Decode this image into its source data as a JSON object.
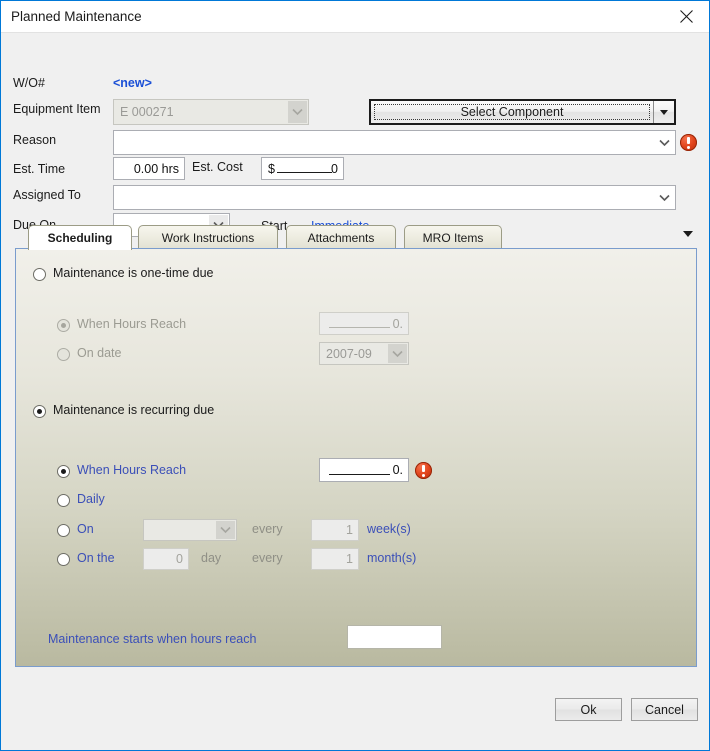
{
  "window": {
    "title": "Planned Maintenance",
    "close_icon": "close-icon"
  },
  "header": {
    "wo_label": "W/O#",
    "wo_value": "<new>",
    "equipment_label": "Equipment Item",
    "equipment_value": "E 000271",
    "select_component_label": "Select Component",
    "reason_label": "Reason",
    "reason_value": "",
    "est_time_label": "Est. Time",
    "est_time_value": "0.00 hrs",
    "est_cost_label": "Est. Cost",
    "est_cost_currency": "$",
    "est_cost_value": "0",
    "assigned_to_label": "Assigned To",
    "assigned_to_value": "",
    "due_on_label": "Due On",
    "due_on_value": "",
    "start_label": "Start",
    "start_value": "Immediate"
  },
  "tabs": [
    {
      "label": "Scheduling",
      "active": true
    },
    {
      "label": "Work Instructions",
      "active": false
    },
    {
      "label": "Attachments",
      "active": false
    },
    {
      "label": "MRO Items",
      "active": false
    }
  ],
  "scheduling": {
    "one_time": {
      "label": "Maintenance is one-time due",
      "selected": false,
      "when_hours_label": "When Hours Reach",
      "when_hours_selected": true,
      "when_hours_value": "0.",
      "on_date_label": "On date",
      "on_date_selected": false,
      "on_date_value": "2007-09"
    },
    "recurring": {
      "label": "Maintenance is recurring due",
      "selected": true,
      "when_hours_label": "When Hours Reach",
      "when_hours_selected": true,
      "when_hours_value": "0.",
      "daily_label": "Daily",
      "daily_selected": false,
      "on_label": "On",
      "on_selected": false,
      "on_day_value": "",
      "on_every_label": "every",
      "on_interval_value": "1",
      "on_unit_label": "week(s)",
      "onthe_label": "On the",
      "onthe_selected": false,
      "onthe_day_value": "0",
      "onthe_day_label": "day",
      "onthe_every_label": "every",
      "onthe_interval_value": "1",
      "onthe_unit_label": "month(s)"
    },
    "starts_label": "Maintenance starts when hours reach",
    "starts_value": ""
  },
  "footer": {
    "ok_label": "Ok",
    "cancel_label": "Cancel"
  },
  "colors": {
    "accent_blue": "#3b4fb8",
    "link_blue": "#1a4fd6",
    "error_red": "#e2451c",
    "panel_border": "#7a9ccd"
  }
}
